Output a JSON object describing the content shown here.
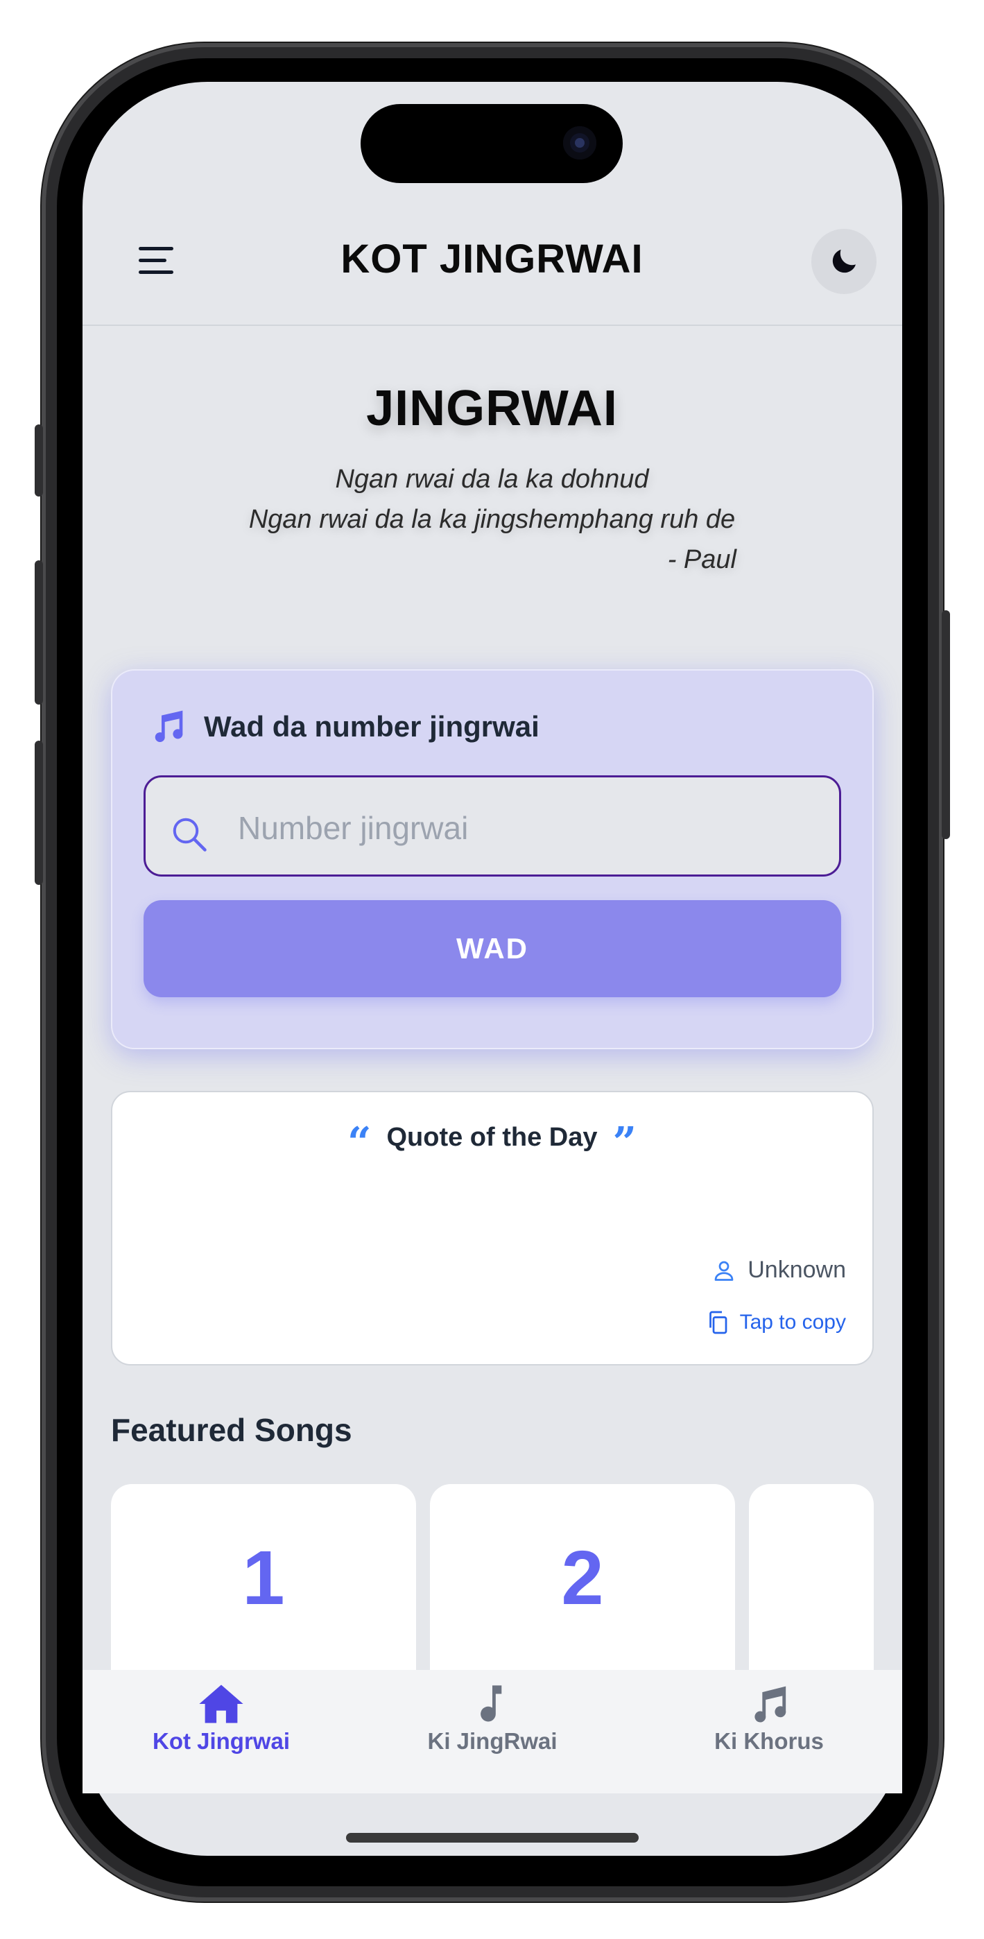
{
  "header": {
    "title": "KOT JINGRWAI",
    "menu_icon": "hamburger-menu-icon",
    "theme_icon": "moon-icon"
  },
  "hero": {
    "title": "JINGRWAI",
    "verse_line1": "Ngan rwai da la ka dohnud",
    "verse_line2": "Ngan rwai da la ka jingshemphang ruh de",
    "verse_author": "- Paul"
  },
  "search": {
    "heading": "Wad da number jingrwai",
    "heading_icon": "music-note-icon",
    "placeholder": "Number jingrwai",
    "button_label": "WAD"
  },
  "quote": {
    "heading": "Quote of the Day",
    "author": "Unknown",
    "copy_label": "Tap to copy"
  },
  "featured": {
    "title": "Featured Songs",
    "songs": [
      {
        "number": "1"
      },
      {
        "number": "2"
      }
    ]
  },
  "nav": {
    "items": [
      {
        "label": "Kot Jingrwai",
        "icon": "home-icon",
        "active": true
      },
      {
        "label": "Ki JingRwai",
        "icon": "music-note-icon",
        "active": false
      },
      {
        "label": "Ki Khorus",
        "icon": "music-notes-icon",
        "active": false
      }
    ]
  },
  "colors": {
    "accent": "#6366f1",
    "nav_active": "#4f46e5",
    "search_card": "#d6d6f4",
    "search_button": "#8b88ec",
    "link": "#2563eb",
    "screen_bg": "#e5e7eb"
  }
}
